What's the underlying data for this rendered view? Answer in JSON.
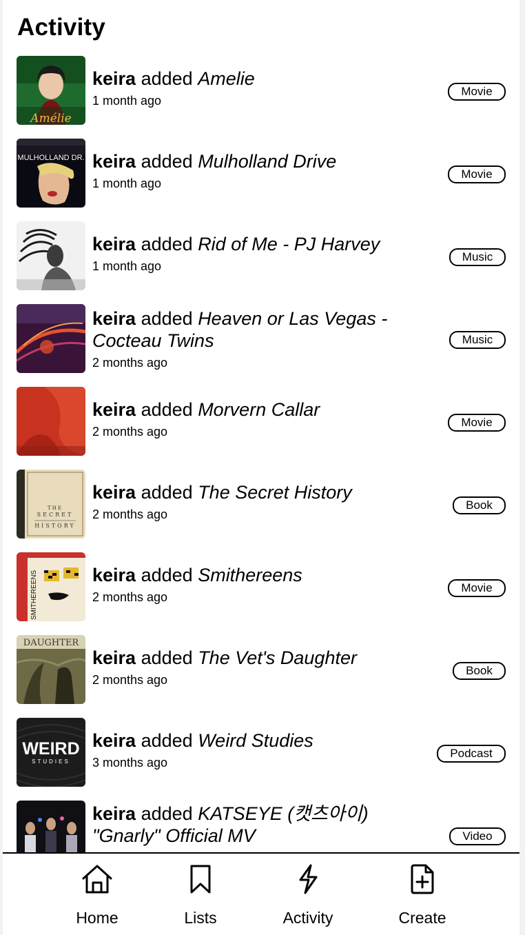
{
  "page": {
    "title": "Activity"
  },
  "feed": [
    {
      "user": "keira",
      "verb": "added",
      "work": "Amelie",
      "time": "1 month ago",
      "type": "Movie",
      "thumb_icon": "amelie-poster"
    },
    {
      "user": "keira",
      "verb": "added",
      "work": "Mulholland Drive",
      "time": "1 month ago",
      "type": "Movie",
      "thumb_icon": "mulholland-drive-poster",
      "poster_text": "MULHOLLAND DR."
    },
    {
      "user": "keira",
      "verb": "added",
      "work": "Rid of Me - PJ Harvey",
      "time": "1 month ago",
      "type": "Music",
      "thumb_icon": "rid-of-me-cover"
    },
    {
      "user": "keira",
      "verb": "added",
      "work": "Heaven or Las Vegas - Cocteau Twins",
      "time": "2 months ago",
      "type": "Music",
      "thumb_icon": "heaven-or-las-vegas-cover"
    },
    {
      "user": "keira",
      "verb": "added",
      "work": "Morvern Callar",
      "time": "2 months ago",
      "type": "Movie",
      "thumb_icon": "morvern-callar-poster"
    },
    {
      "user": "keira",
      "verb": "added",
      "work": "The Secret History",
      "time": "2 months ago",
      "type": "Book",
      "thumb_icon": "secret-history-cover",
      "cover_text": [
        "THE",
        "SECRET",
        "HISTORY"
      ]
    },
    {
      "user": "keira",
      "verb": "added",
      "work": "Smithereens",
      "time": "2 months ago",
      "type": "Movie",
      "thumb_icon": "smithereens-poster",
      "poster_text": "SMITHEREENS"
    },
    {
      "user": "keira",
      "verb": "added",
      "work": "The Vet's Daughter",
      "time": "2 months ago",
      "type": "Book",
      "thumb_icon": "vets-daughter-cover",
      "cover_text": "DAUGHTER"
    },
    {
      "user": "keira",
      "verb": "added",
      "work": "Weird Studies",
      "time": "3 months ago",
      "type": "Podcast",
      "thumb_icon": "weird-studies-cover",
      "cover_text": [
        "WEIRD",
        "STUDIES"
      ]
    },
    {
      "user": "keira",
      "verb": "added",
      "work": "KATSEYE (캣츠아이) \"Gnarly\" Official MV",
      "time": "",
      "type": "Video",
      "thumb_icon": "katseye-video-thumbnail"
    }
  ],
  "nav": [
    {
      "label": "Home",
      "icon": "home-icon"
    },
    {
      "label": "Lists",
      "icon": "bookmark-icon"
    },
    {
      "label": "Activity",
      "icon": "bolt-icon"
    },
    {
      "label": "Create",
      "icon": "file-plus-icon"
    }
  ]
}
